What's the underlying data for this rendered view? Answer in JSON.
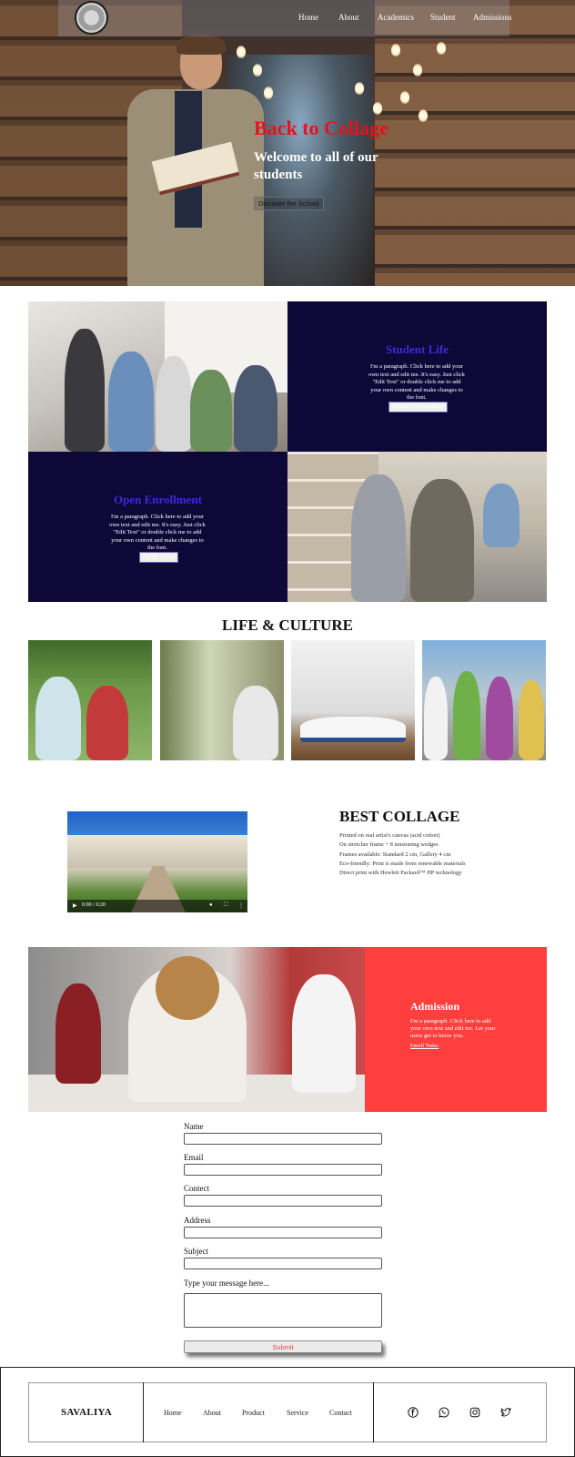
{
  "nav": {
    "items": [
      "Home",
      "About",
      "Academics",
      "Student",
      "Admissions"
    ]
  },
  "hero": {
    "title": "Back to Collage",
    "subtitle": "Welcome to all of our students",
    "button": "Discover the School"
  },
  "student_life": {
    "title": "Student Life",
    "text": "I'm a paragraph. Click here to add your own text and edit me. It's easy. Just click \"Edit Text\" or double click me to add your own content and make changes to the font.",
    "button": "Student Information"
  },
  "enrollment": {
    "title": "Open Enrollment",
    "text": "I'm a paragraph. Click here to add your own text and edit me. It's easy. Just click \"Edit Text\" or double click me to add your own content and make changes to the font.",
    "button": "Apply Today"
  },
  "life_culture": {
    "title": "LIFE & CULTURE"
  },
  "video": {
    "time": "0:00 / 0:20"
  },
  "best": {
    "title": "BEST COLLAGE",
    "lines": [
      "Printed on real artist's canvas (acid cotton)",
      "On stretcher frame + 8 tensioning wedges",
      "Frames available: Standard 2 cm, Gallery 4 cm",
      "Eco-friendly: Print is made from renewable materials",
      "Direct print with Hewlett Packard™ HP technology"
    ]
  },
  "admission": {
    "title": "Admission",
    "text": "I'm a paragraph. Click here to add your own text and edit me. Let your users get to know you.",
    "link": "Enroll Today"
  },
  "form": {
    "name_label": "Name",
    "email_label": "Email",
    "contact_label": "Contect",
    "address_label": "Address",
    "subject_label": "Subject",
    "message_label": "Type your message here...",
    "submit": "Submit"
  },
  "footer": {
    "brand": "SAVALIYA",
    "links": [
      "Home",
      "About",
      "Product",
      "Service",
      "Contact"
    ],
    "social_icons": [
      "facebook-icon",
      "whatsapp-icon",
      "instagram-icon",
      "twitter-icon"
    ]
  },
  "colors": {
    "accent_red": "#e0141d",
    "navy": "#0d0837",
    "panel_title": "#3f2bd6",
    "admission_red": "#ff3e3e"
  }
}
